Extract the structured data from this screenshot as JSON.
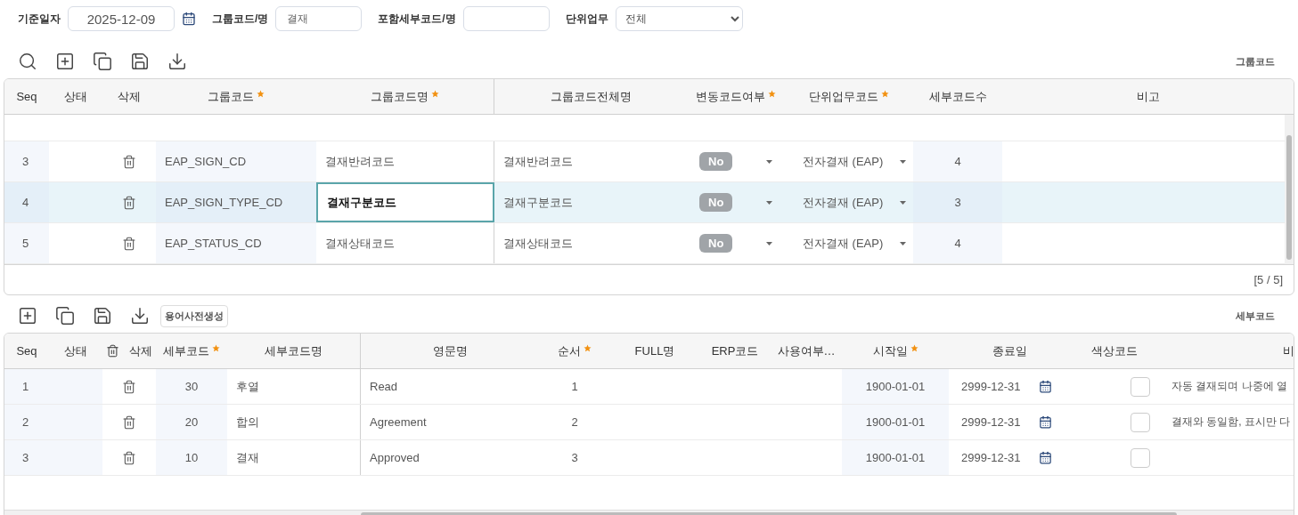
{
  "filters": [
    {
      "kind": "date",
      "label": "기준일자",
      "value": "2025-12-09"
    },
    {
      "kind": "text",
      "label": "그룹코드/명",
      "value": "결재"
    },
    {
      "kind": "text",
      "label": "포함세부코드/명"
    },
    {
      "kind": "select",
      "label": "단위업무",
      "value": "전체"
    }
  ],
  "group_grid": {
    "title": "그룹코드",
    "columns": [
      {
        "label": "Seq",
        "required": false
      },
      {
        "label": "상태",
        "required": false
      },
      {
        "label": "삭제",
        "required": false
      },
      {
        "label": "그룹코드",
        "required": true
      },
      {
        "label": "그룹코드명",
        "required": true
      },
      {
        "label": "그룹코드전체명",
        "required": false
      },
      {
        "label": "변동코드여부",
        "required": true
      },
      {
        "label": "단위업무코드",
        "required": true
      },
      {
        "label": "세부코드수",
        "required": false
      },
      {
        "label": "비고",
        "required": false
      }
    ],
    "rows": [
      {
        "seq": "3",
        "code": "EAP_SIGN_CD",
        "name": "결재반려코드",
        "full_name": "결재반려코드",
        "variable": "No",
        "unit": "전자결재 (EAP)",
        "count": "4",
        "selected": false,
        "editing": false
      },
      {
        "seq": "4",
        "code": "EAP_SIGN_TYPE_CD",
        "name": "결재구분코드",
        "full_name": "결재구분코드",
        "variable": "No",
        "unit": "전자결재 (EAP)",
        "count": "3",
        "selected": true,
        "editing": true
      },
      {
        "seq": "5",
        "code": "EAP_STATUS_CD",
        "name": "결재상태코드",
        "full_name": "결재상태코드",
        "variable": "No",
        "unit": "전자결재 (EAP)",
        "count": "4",
        "selected": false,
        "editing": false
      }
    ],
    "footer": "[5 / 5]"
  },
  "detail_grid": {
    "title": "세부코드",
    "button": "용어사전생성",
    "columns": [
      {
        "label": "Seq",
        "required": false,
        "kind": "plain"
      },
      {
        "label": "상태",
        "required": false,
        "kind": "plain"
      },
      {
        "label": "삭제",
        "required": false,
        "kind": "trash"
      },
      {
        "label": "세부코드",
        "required": true,
        "kind": "plain"
      },
      {
        "label": "세부코드명",
        "required": false,
        "kind": "plain"
      },
      {
        "label": "영문명",
        "required": false,
        "kind": "plain"
      },
      {
        "label": "순서",
        "required": true,
        "kind": "plain"
      },
      {
        "label": "FULL명",
        "required": false,
        "kind": "plain"
      },
      {
        "label": "ERP코드",
        "required": false,
        "kind": "plain"
      },
      {
        "label": "사용여부…",
        "required": false,
        "kind": "plain"
      },
      {
        "label": "시작일",
        "required": true,
        "kind": "plain"
      },
      {
        "label": "종료일",
        "required": false,
        "kind": "plain"
      },
      {
        "label": "색상코드",
        "required": false,
        "kind": "plain"
      },
      {
        "label": "비",
        "required": false,
        "kind": "plain"
      }
    ],
    "rows": [
      {
        "seq": "1",
        "code": "30",
        "name": "후열",
        "english": "Read",
        "order": "1",
        "start": "1900-01-01",
        "end": "2999-12-31",
        "remark": "자동 결재되며 나중에 열"
      },
      {
        "seq": "2",
        "code": "20",
        "name": "합의",
        "english": "Agreement",
        "order": "2",
        "start": "1900-01-01",
        "end": "2999-12-31",
        "remark": "결재와 동일함, 표시만 다"
      },
      {
        "seq": "3",
        "code": "10",
        "name": "결재",
        "english": "Approved",
        "order": "3",
        "start": "1900-01-01",
        "end": "2999-12-31"
      }
    ]
  }
}
